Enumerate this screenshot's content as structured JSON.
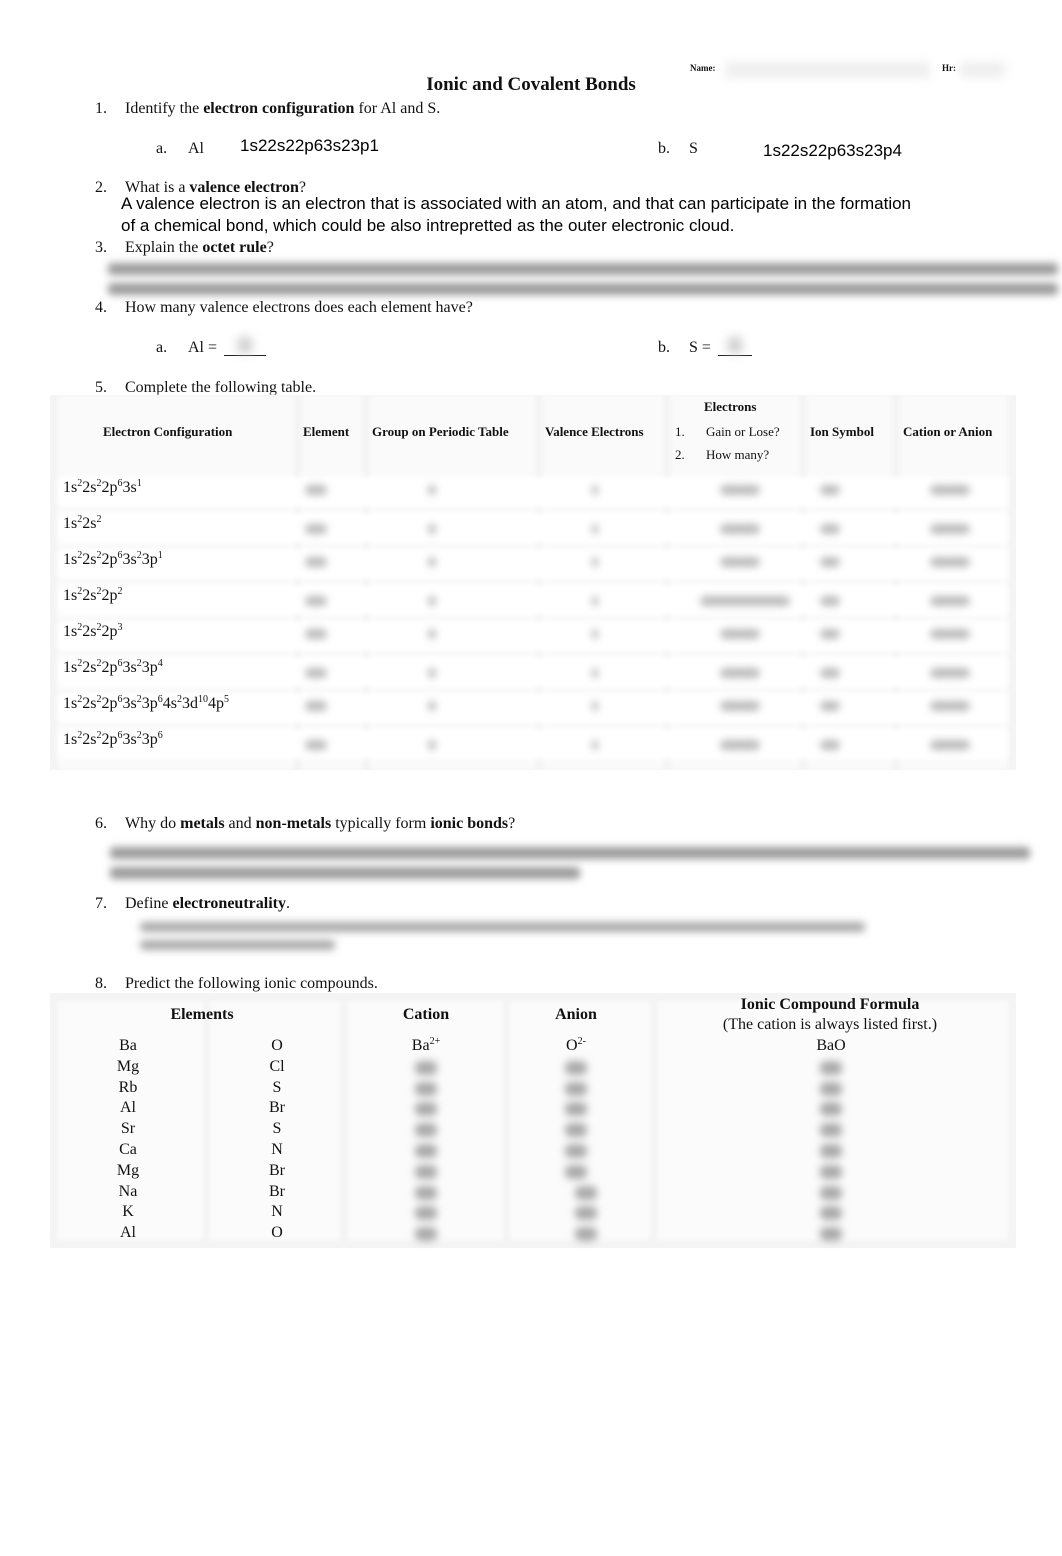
{
  "header": {
    "title": "Ionic and Covalent Bonds",
    "name_label": "Name:",
    "hour_label": "Hr:"
  },
  "q1": {
    "number": "1.",
    "prefix": "Identify the ",
    "bold": "electron configuration",
    "suffix": " for Al and S.",
    "a_label": "a.",
    "a_element": "Al",
    "a_answer": "1s22s22p63s23p1",
    "b_label": "b.",
    "b_element": "S",
    "b_answer": "1s22s22p63s23p4"
  },
  "q2": {
    "number": "2.",
    "prefix": "What is a ",
    "bold": "valence electron",
    "suffix": "?",
    "answer_line1": "A valence electron is an electron that is associated with an atom, and that can participate in the formation",
    "answer_line2": "of a chemical bond, which could be also intrepretted as the outer electronic cloud."
  },
  "q3": {
    "number": "3.",
    "prefix": "Explain the ",
    "bold": "octet rule",
    "suffix": "?"
  },
  "q4": {
    "number": "4.",
    "text": "How many valence electrons does each element have?",
    "a_label": "a.",
    "a_text": "Al = ",
    "b_label": "b.",
    "b_text": "S = "
  },
  "q5": {
    "number": "5.",
    "text": "Complete the following table.",
    "columns": {
      "config": "Electron Configuration",
      "element": "Element",
      "group": "Group on Periodic Table",
      "valence": "Valence Electrons",
      "electrons": "Electrons",
      "electrons_item1_num": "1.",
      "electrons_item1": "Gain or Lose?",
      "electrons_item2_num": "2.",
      "electrons_item2": "How many?",
      "ion_symbol": "Ion Symbol",
      "cation_anion": "Cation or Anion"
    },
    "rows": [
      {
        "config": [
          [
            "1s",
            "2"
          ],
          [
            "2s",
            "2"
          ],
          [
            "2p",
            "6"
          ],
          [
            "3s",
            "1"
          ]
        ]
      },
      {
        "config": [
          [
            "1s",
            "2"
          ],
          [
            "2s",
            "2"
          ]
        ]
      },
      {
        "config": [
          [
            "1s",
            "2"
          ],
          [
            "2s",
            "2"
          ],
          [
            "2p",
            "6"
          ],
          [
            "3s",
            "2"
          ],
          [
            "3p",
            "1"
          ]
        ]
      },
      {
        "config": [
          [
            "1s",
            "2"
          ],
          [
            "2s",
            "2"
          ],
          [
            "2p",
            "2"
          ]
        ]
      },
      {
        "config": [
          [
            "1s",
            "2"
          ],
          [
            "2s",
            "2"
          ],
          [
            "2p",
            "3"
          ]
        ]
      },
      {
        "config": [
          [
            "1s",
            "2"
          ],
          [
            "2s",
            "2"
          ],
          [
            "2p",
            "6"
          ],
          [
            "3s",
            "2"
          ],
          [
            "3p",
            "4"
          ]
        ]
      },
      {
        "config": [
          [
            "1s",
            "2"
          ],
          [
            "2s",
            "2"
          ],
          [
            "2p",
            "6"
          ],
          [
            "3s",
            "2"
          ],
          [
            "3p",
            "6"
          ],
          [
            "4s",
            "2"
          ],
          [
            "3d",
            "10"
          ],
          [
            "4p",
            "5"
          ]
        ]
      },
      {
        "config": [
          [
            "1s",
            "2"
          ],
          [
            "2s",
            "2"
          ],
          [
            "2p",
            "6"
          ],
          [
            "3s",
            "2"
          ],
          [
            "3p",
            "6"
          ]
        ]
      }
    ]
  },
  "q6": {
    "number": "6.",
    "parts": [
      {
        "t": "Why do ",
        "b": false
      },
      {
        "t": "metals",
        "b": true
      },
      {
        "t": " and ",
        "b": false
      },
      {
        "t": "non-metals",
        "b": true
      },
      {
        "t": " typically form ",
        "b": false
      },
      {
        "t": "ionic bonds",
        "b": true
      },
      {
        "t": "?",
        "b": false
      }
    ]
  },
  "q7": {
    "number": "7.",
    "prefix": "Define ",
    "bold": "electroneutrality",
    "suffix": "."
  },
  "q8": {
    "number": "8.",
    "text": "Predict the following ionic compounds.",
    "columns": {
      "elements": "Elements",
      "cation": "Cation",
      "anion": "Anion",
      "formula": "Ionic Compound Formula",
      "formula_note": "(The cation is always listed first.)"
    },
    "rows": [
      {
        "el1": "Ba",
        "el2": "O",
        "cation": "Ba",
        "cation_charge": "2+",
        "anion": "O",
        "anion_charge": "2-",
        "formula": "BaO"
      },
      {
        "el1": "Mg",
        "el2": "Cl"
      },
      {
        "el1": "Rb",
        "el2": "S"
      },
      {
        "el1": "Al",
        "el2": "Br"
      },
      {
        "el1": "Sr",
        "el2": "S"
      },
      {
        "el1": "Ca",
        "el2": "N"
      },
      {
        "el1": "Mg",
        "el2": "Br"
      },
      {
        "el1": "Na",
        "el2": "Br"
      },
      {
        "el1": "K",
        "el2": "N"
      },
      {
        "el1": "Al",
        "el2": "O"
      }
    ]
  }
}
